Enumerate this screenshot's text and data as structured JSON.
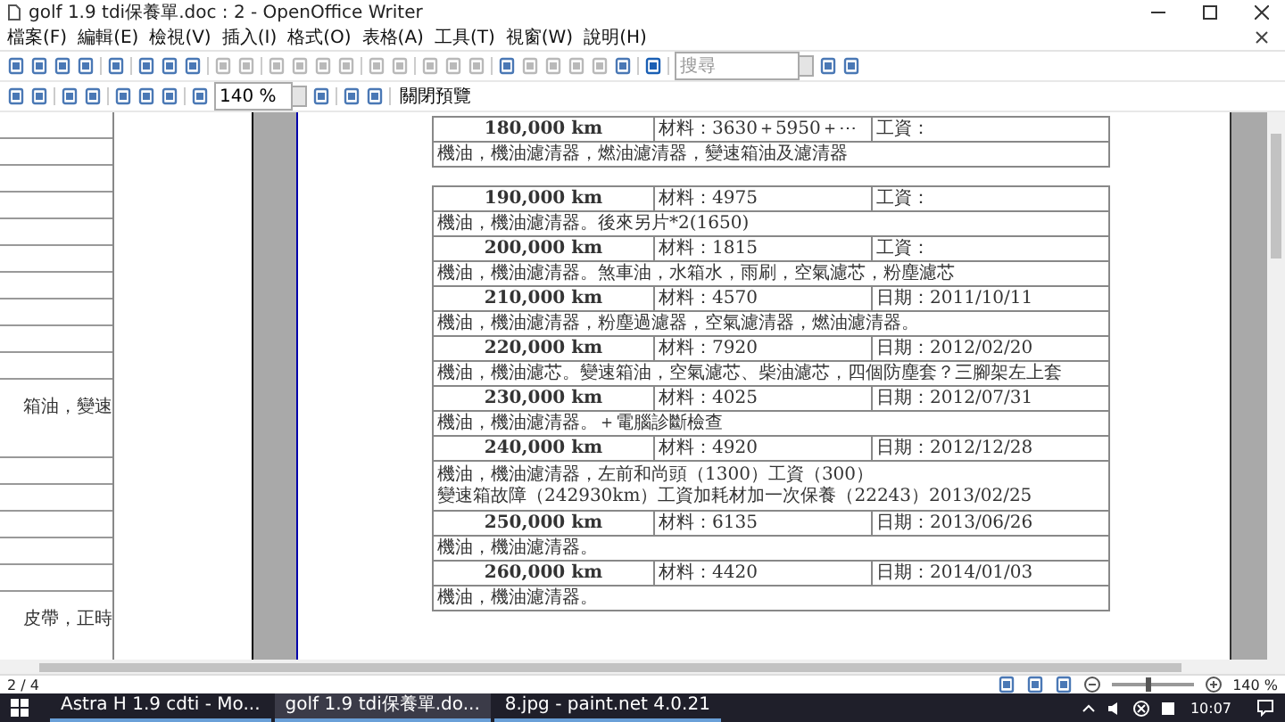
{
  "window": {
    "title": "golf 1.9 tdi保養單.doc : 2 - OpenOffice Writer"
  },
  "menu": [
    "檔案(F)",
    "編輯(E)",
    "檢視(V)",
    "插入(I)",
    "格式(O)",
    "表格(A)",
    "工具(T)",
    "視窗(W)",
    "說明(H)"
  ],
  "toolbar": {
    "search": {
      "placeholder": "搜尋"
    },
    "zoom": {
      "value": "140 %"
    },
    "close_preview": "關閉預覽"
  },
  "left_page": {
    "cell_texts": [
      "箱油，變速",
      "皮帶，正時"
    ]
  },
  "tables": [
    {
      "entries": [
        {
          "km": "180,000 km",
          "material": "材料：3630＋5950＋⋯",
          "info": "工資：",
          "notes": [
            "機油，機油濾清器，燃油濾清器，變速箱油及濾清器"
          ]
        }
      ]
    },
    {
      "entries": [
        {
          "km": "190,000 km",
          "material": "材料：4975",
          "info": "工資：",
          "notes": [
            "機油，機油濾清器。後來另片*2(1650)"
          ]
        },
        {
          "km": "200,000 km",
          "material": "材料：1815",
          "info": "工資：",
          "notes": [
            "機油，機油濾清器。煞車油，水箱水，雨刷，空氣濾芯，粉塵濾芯"
          ]
        },
        {
          "km": "210,000 km",
          "material": "材料：4570",
          "info": "日期：2011/10/11",
          "notes": [
            "機油，機油濾清器，粉塵過濾器，空氣濾清器，燃油濾清器。"
          ]
        },
        {
          "km": "220,000 km",
          "material": "材料：7920",
          "info": "日期：2012/02/20",
          "notes": [
            "機油，機油濾芯。變速箱油，空氣濾芯、柴油濾芯，四個防塵套？三腳架左上套"
          ]
        },
        {
          "km": "230,000 km",
          "material": "材料：4025",
          "info": "日期：2012/07/31",
          "notes": [
            "機油，機油濾清器。＋電腦診斷檢查"
          ]
        },
        {
          "km": "240,000 km",
          "material": "材料：4920",
          "info": "日期：2012/12/28",
          "notes": [
            "機油，機油濾清器，左前和尚頭（1300）工資（300）",
            "變速箱故障（242930km）工資加耗材加一次保養（22243）2013/02/25"
          ]
        },
        {
          "km": "250,000 km",
          "material": "材料：6135",
          "info": "日期：2013/06/26",
          "notes": [
            "機油，機油濾清器。"
          ]
        },
        {
          "km": "260,000 km",
          "material": "材料：4420",
          "info": "日期：2014/01/03",
          "notes": [
            "機油，機油濾清器。"
          ]
        }
      ]
    }
  ],
  "status_bar": {
    "page": "2 / 4",
    "zoom": "140 %",
    "zoom_slider": {
      "level": 0.45
    }
  },
  "taskbar": {
    "tasks": [
      {
        "label": "Astra H 1.9 cdti - Mo...",
        "selected": false
      },
      {
        "label": "golf 1.9 tdi保養單.do...",
        "selected": true
      },
      {
        "label": "8.jpg - paint.net 4.0.21",
        "selected": false
      }
    ],
    "clock": "10:07"
  }
}
